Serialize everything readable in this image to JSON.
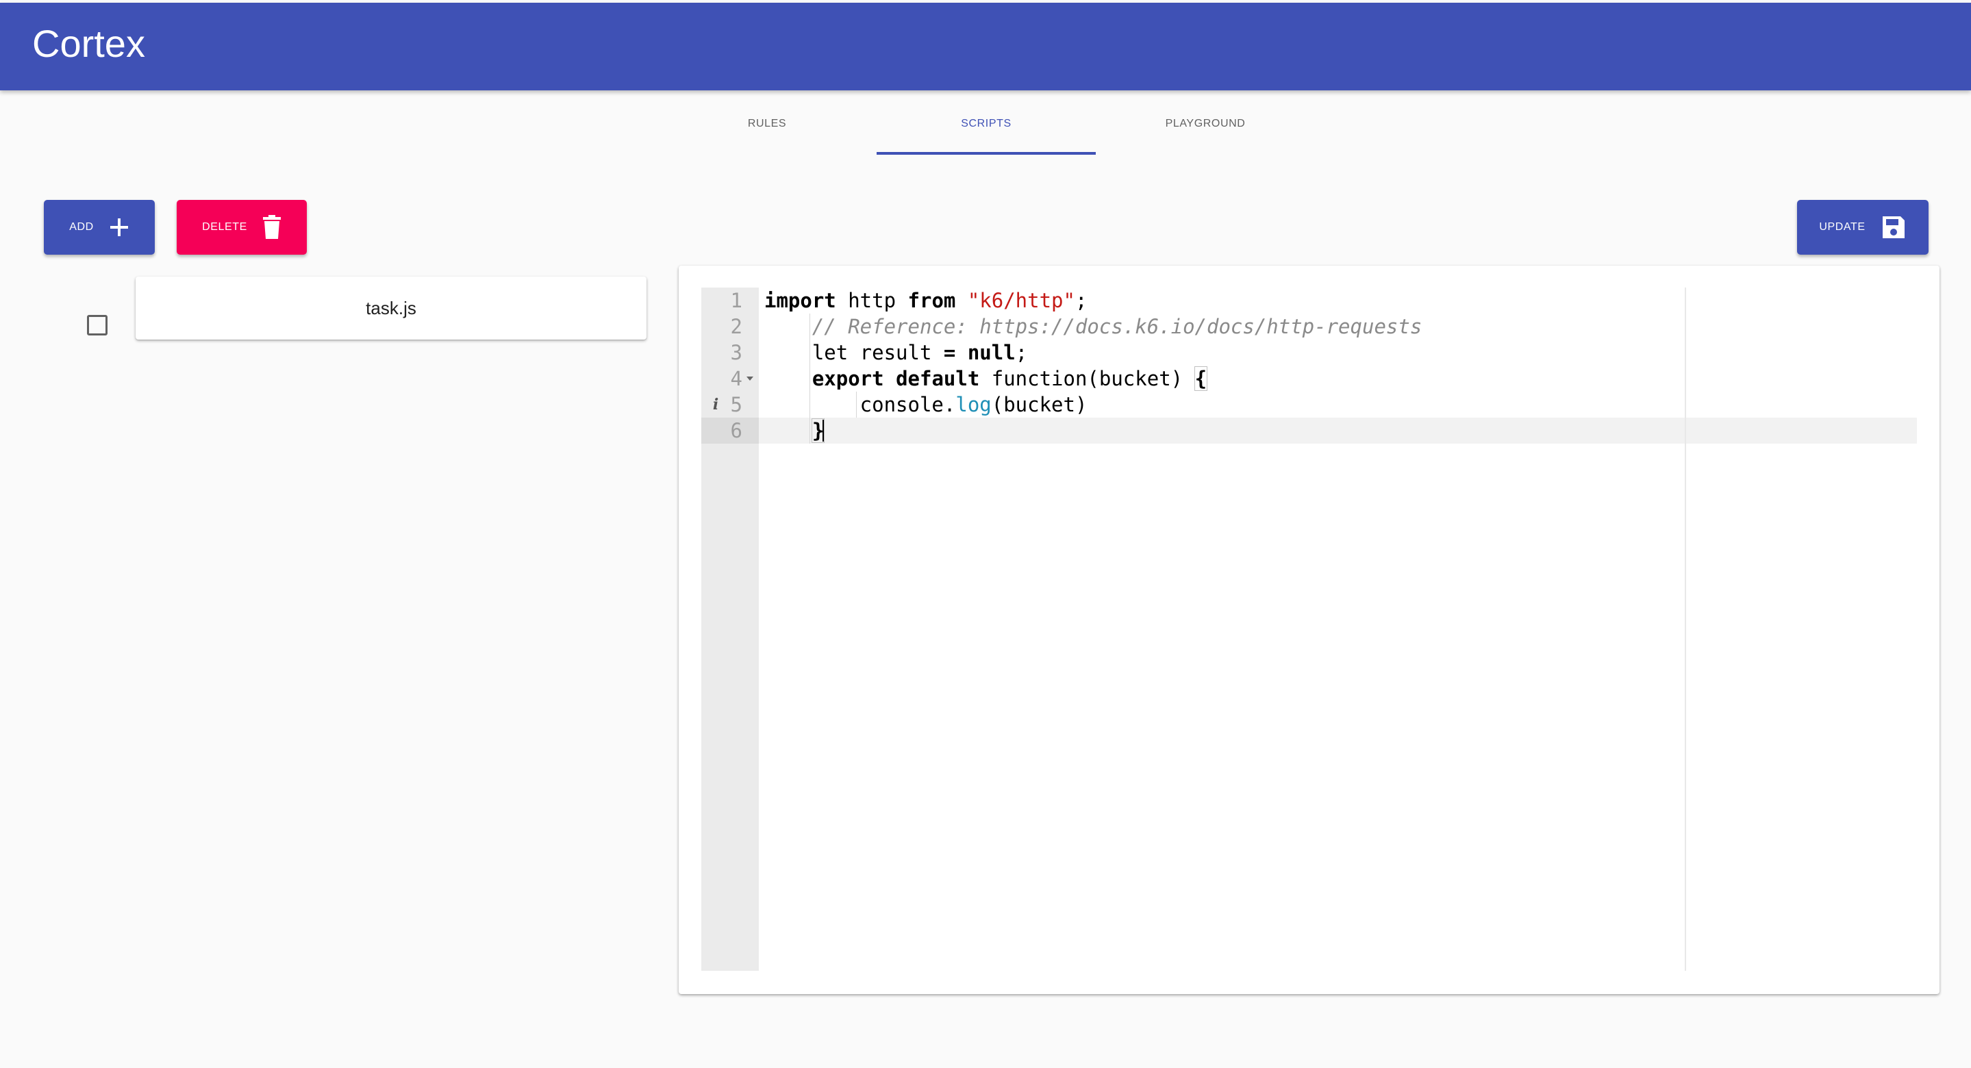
{
  "app": {
    "title": "Cortex"
  },
  "tabs": [
    {
      "label": "RULES",
      "active": false
    },
    {
      "label": "SCRIPTS",
      "active": true
    },
    {
      "label": "PLAYGROUND",
      "active": false
    }
  ],
  "toolbar": {
    "add_label": "ADD",
    "add_icon": "plus-icon",
    "delete_label": "DELETE",
    "delete_icon": "trash-icon",
    "update_label": "UPDATE",
    "update_icon": "save-icon"
  },
  "files": [
    {
      "name": "task.js",
      "checked": false
    }
  ],
  "editor": {
    "line_numbers": [
      "1",
      "2",
      "3",
      "4",
      "5",
      "6"
    ],
    "lines": [
      {
        "parts": [
          {
            "t": "import",
            "c": "kw"
          },
          {
            "t": " http ",
            "c": ""
          },
          {
            "t": "from",
            "c": "kw"
          },
          {
            "t": " ",
            "c": ""
          },
          {
            "t": "\"k6/http\"",
            "c": "str"
          },
          {
            "t": ";",
            "c": ""
          }
        ]
      },
      {
        "parts": [
          {
            "t": "    ",
            "c": ""
          },
          {
            "t": "// Reference: https://docs.k6.io/docs/http-requests",
            "c": "cmt"
          }
        ]
      },
      {
        "parts": [
          {
            "t": "    let result ",
            "c": ""
          },
          {
            "t": "=",
            "c": "kw"
          },
          {
            "t": " ",
            "c": ""
          },
          {
            "t": "null",
            "c": "kw"
          },
          {
            "t": ";",
            "c": ""
          }
        ]
      },
      {
        "parts": [
          {
            "t": "    ",
            "c": ""
          },
          {
            "t": "export",
            "c": "kw"
          },
          {
            "t": " ",
            "c": ""
          },
          {
            "t": "default",
            "c": "kw"
          },
          {
            "t": " function(bucket) ",
            "c": ""
          },
          {
            "t": "{",
            "c": "bracket"
          }
        ]
      },
      {
        "parts": [
          {
            "t": "        console.",
            "c": ""
          },
          {
            "t": "log",
            "c": "fn"
          },
          {
            "t": "(bucket)",
            "c": ""
          }
        ]
      },
      {
        "parts": [
          {
            "t": "    ",
            "c": ""
          },
          {
            "t": "}",
            "c": "bracket"
          }
        ]
      }
    ],
    "fold_line": 4,
    "info_line": 5,
    "active_line": 6,
    "info_marker": "i",
    "colors": {
      "keyword": "#000000",
      "string": "#c41a16",
      "comment": "#8a8a8a",
      "function": "#1f8fb6"
    }
  },
  "colors": {
    "primary": "#3f51b5",
    "secondary": "#f50057",
    "background": "#fafafa"
  }
}
